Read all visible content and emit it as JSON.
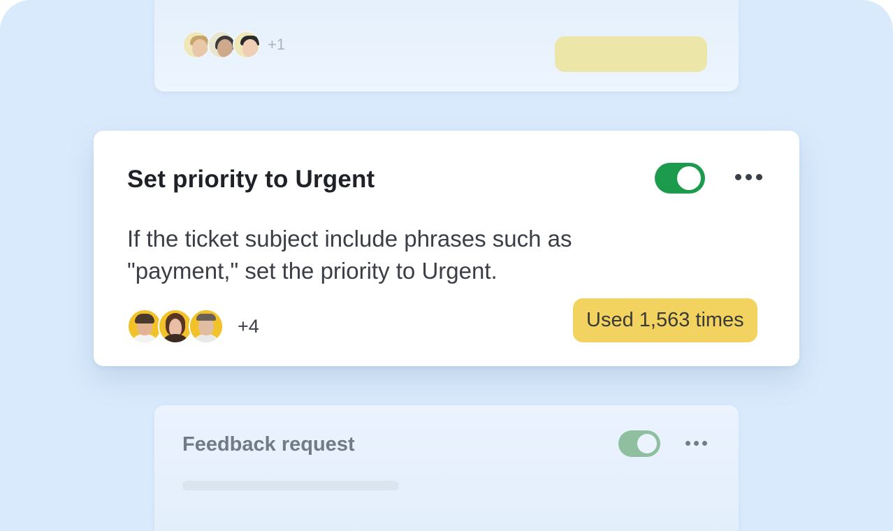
{
  "top_card": {
    "extra_count": "+1"
  },
  "main_card": {
    "title": "Set priority to Urgent",
    "description": "If the ticket subject include phrases such as \"payment,\" set the priority to Urgent.",
    "toggle_on": true,
    "extra_count": "+4",
    "usage_badge": "Used 1,563 times"
  },
  "bottom_card": {
    "title": "Feedback request",
    "toggle_on": true
  },
  "colors": {
    "background": "#d9eafc",
    "toggle_on": "#1c9b4c",
    "badge": "#f2d35f",
    "avatar_ring": "#f2c22a"
  },
  "icons": {
    "more": "more-horizontal-icon"
  }
}
